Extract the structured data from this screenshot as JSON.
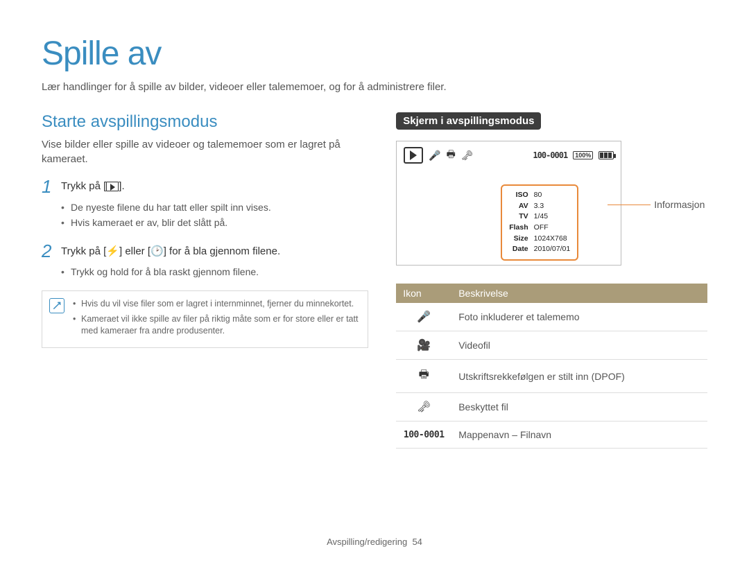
{
  "page": {
    "title": "Spille av",
    "subtitle": "Lær handlinger for å spille av bilder, videoer eller talememoer, og for å administrere filer."
  },
  "left": {
    "heading": "Starte avspillingsmodus",
    "subheading": "Vise bilder eller spille av videoer og talememoer som er lagret på kameraet.",
    "step1_num": "1",
    "step1_text_a": "Trykk på [",
    "step1_text_b": "].",
    "step1_bullets": [
      "De nyeste filene du har tatt eller spilt inn vises.",
      "Hvis kameraet er av, blir det slått på."
    ],
    "step2_num": "2",
    "step2_text_a": "Trykk på [",
    "step2_text_b": "] eller [",
    "step2_text_c": "] for å bla gjennom filene.",
    "step2_bullets": [
      "Trykk og hold for å bla raskt gjennom filene."
    ],
    "notes": [
      "Hvis du vil vise filer som er lagret i internminnet, fjerner du minnekortet.",
      "Kameraet vil ikke spille av filer på riktig måte som er for store eller er tatt med kameraer fra andre produsenter."
    ]
  },
  "right": {
    "pill": "Skjerm i avspillingsmodus",
    "file_number": "100-0001",
    "card_badge": "100%",
    "info_label": "Informasjon",
    "info_rows": [
      {
        "k": "ISO",
        "v": "80"
      },
      {
        "k": "AV",
        "v": "3.3"
      },
      {
        "k": "TV",
        "v": "1/45"
      },
      {
        "k": "Flash",
        "v": "OFF"
      },
      {
        "k": "Size",
        "v": "1024X768"
      },
      {
        "k": "Date",
        "v": "2010/07/01"
      }
    ],
    "table": {
      "head_icon": "Ikon",
      "head_desc": "Beskrivelse",
      "rows": [
        {
          "icon": "mic",
          "desc": "Foto inkluderer et talememo"
        },
        {
          "icon": "film",
          "desc": "Videofil"
        },
        {
          "icon": "print",
          "desc": "Utskriftsrekkefølgen er stilt inn (DPOF)"
        },
        {
          "icon": "key",
          "desc": "Beskyttet fil"
        },
        {
          "icon": "folder",
          "desc": "Mappenavn – Filnavn"
        }
      ]
    },
    "folder_text": "100-0001"
  },
  "footer": {
    "section": "Avspilling/redigering",
    "page": "54"
  }
}
